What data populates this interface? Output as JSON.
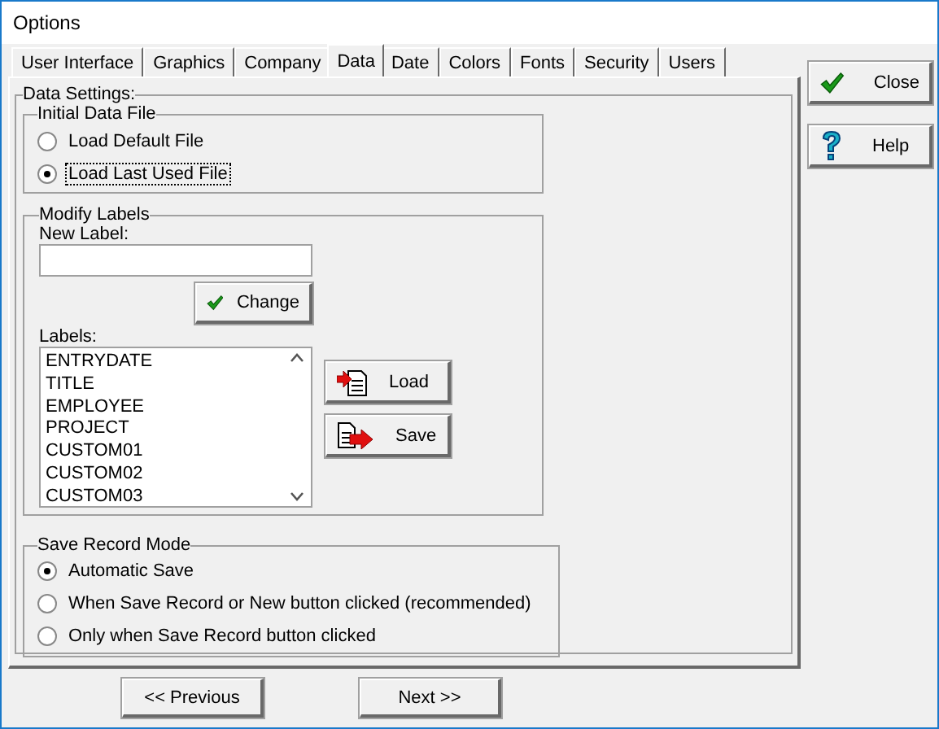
{
  "window": {
    "title": "Options"
  },
  "tabs": [
    {
      "label": "User Interface",
      "selected": false
    },
    {
      "label": "Graphics",
      "selected": false
    },
    {
      "label": "Company",
      "selected": false
    },
    {
      "label": "Data",
      "selected": true
    },
    {
      "label": "Date",
      "selected": false
    },
    {
      "label": "Colors",
      "selected": false
    },
    {
      "label": "Fonts",
      "selected": false
    },
    {
      "label": "Security",
      "selected": false
    },
    {
      "label": "Users",
      "selected": false
    }
  ],
  "side_buttons": [
    {
      "kind": "check",
      "label": "Close"
    },
    {
      "kind": "help",
      "label": "Help"
    }
  ],
  "data_settings": {
    "title": "Data Settings:",
    "initial_data_file": {
      "title": "Initial Data File",
      "options": [
        {
          "label": "Load Default File",
          "selected": false
        },
        {
          "label": "Load Last Used File",
          "selected": true
        }
      ]
    },
    "modify_labels": {
      "title": "Modify Labels",
      "new_label": "New Label:",
      "change_button": "Change",
      "labels_caption": "Labels:",
      "labels": [
        "ENTRYDATE",
        "TITLE",
        "EMPLOYEE",
        "PROJECT",
        "CUSTOM01",
        "CUSTOM02",
        "CUSTOM03"
      ],
      "buttons": [
        {
          "kind": "load",
          "label": "Load"
        },
        {
          "kind": "save",
          "label": "Save"
        }
      ]
    },
    "save_record_mode": {
      "title": "Save Record Mode",
      "options": [
        {
          "label": "Automatic Save",
          "selected": true
        },
        {
          "label": "When Save Record or New button clicked (recommended)",
          "selected": false
        },
        {
          "label": "Only when Save Record button clicked",
          "selected": false
        }
      ]
    }
  },
  "nav_buttons": [
    "<< Previous",
    "Next >>"
  ]
}
